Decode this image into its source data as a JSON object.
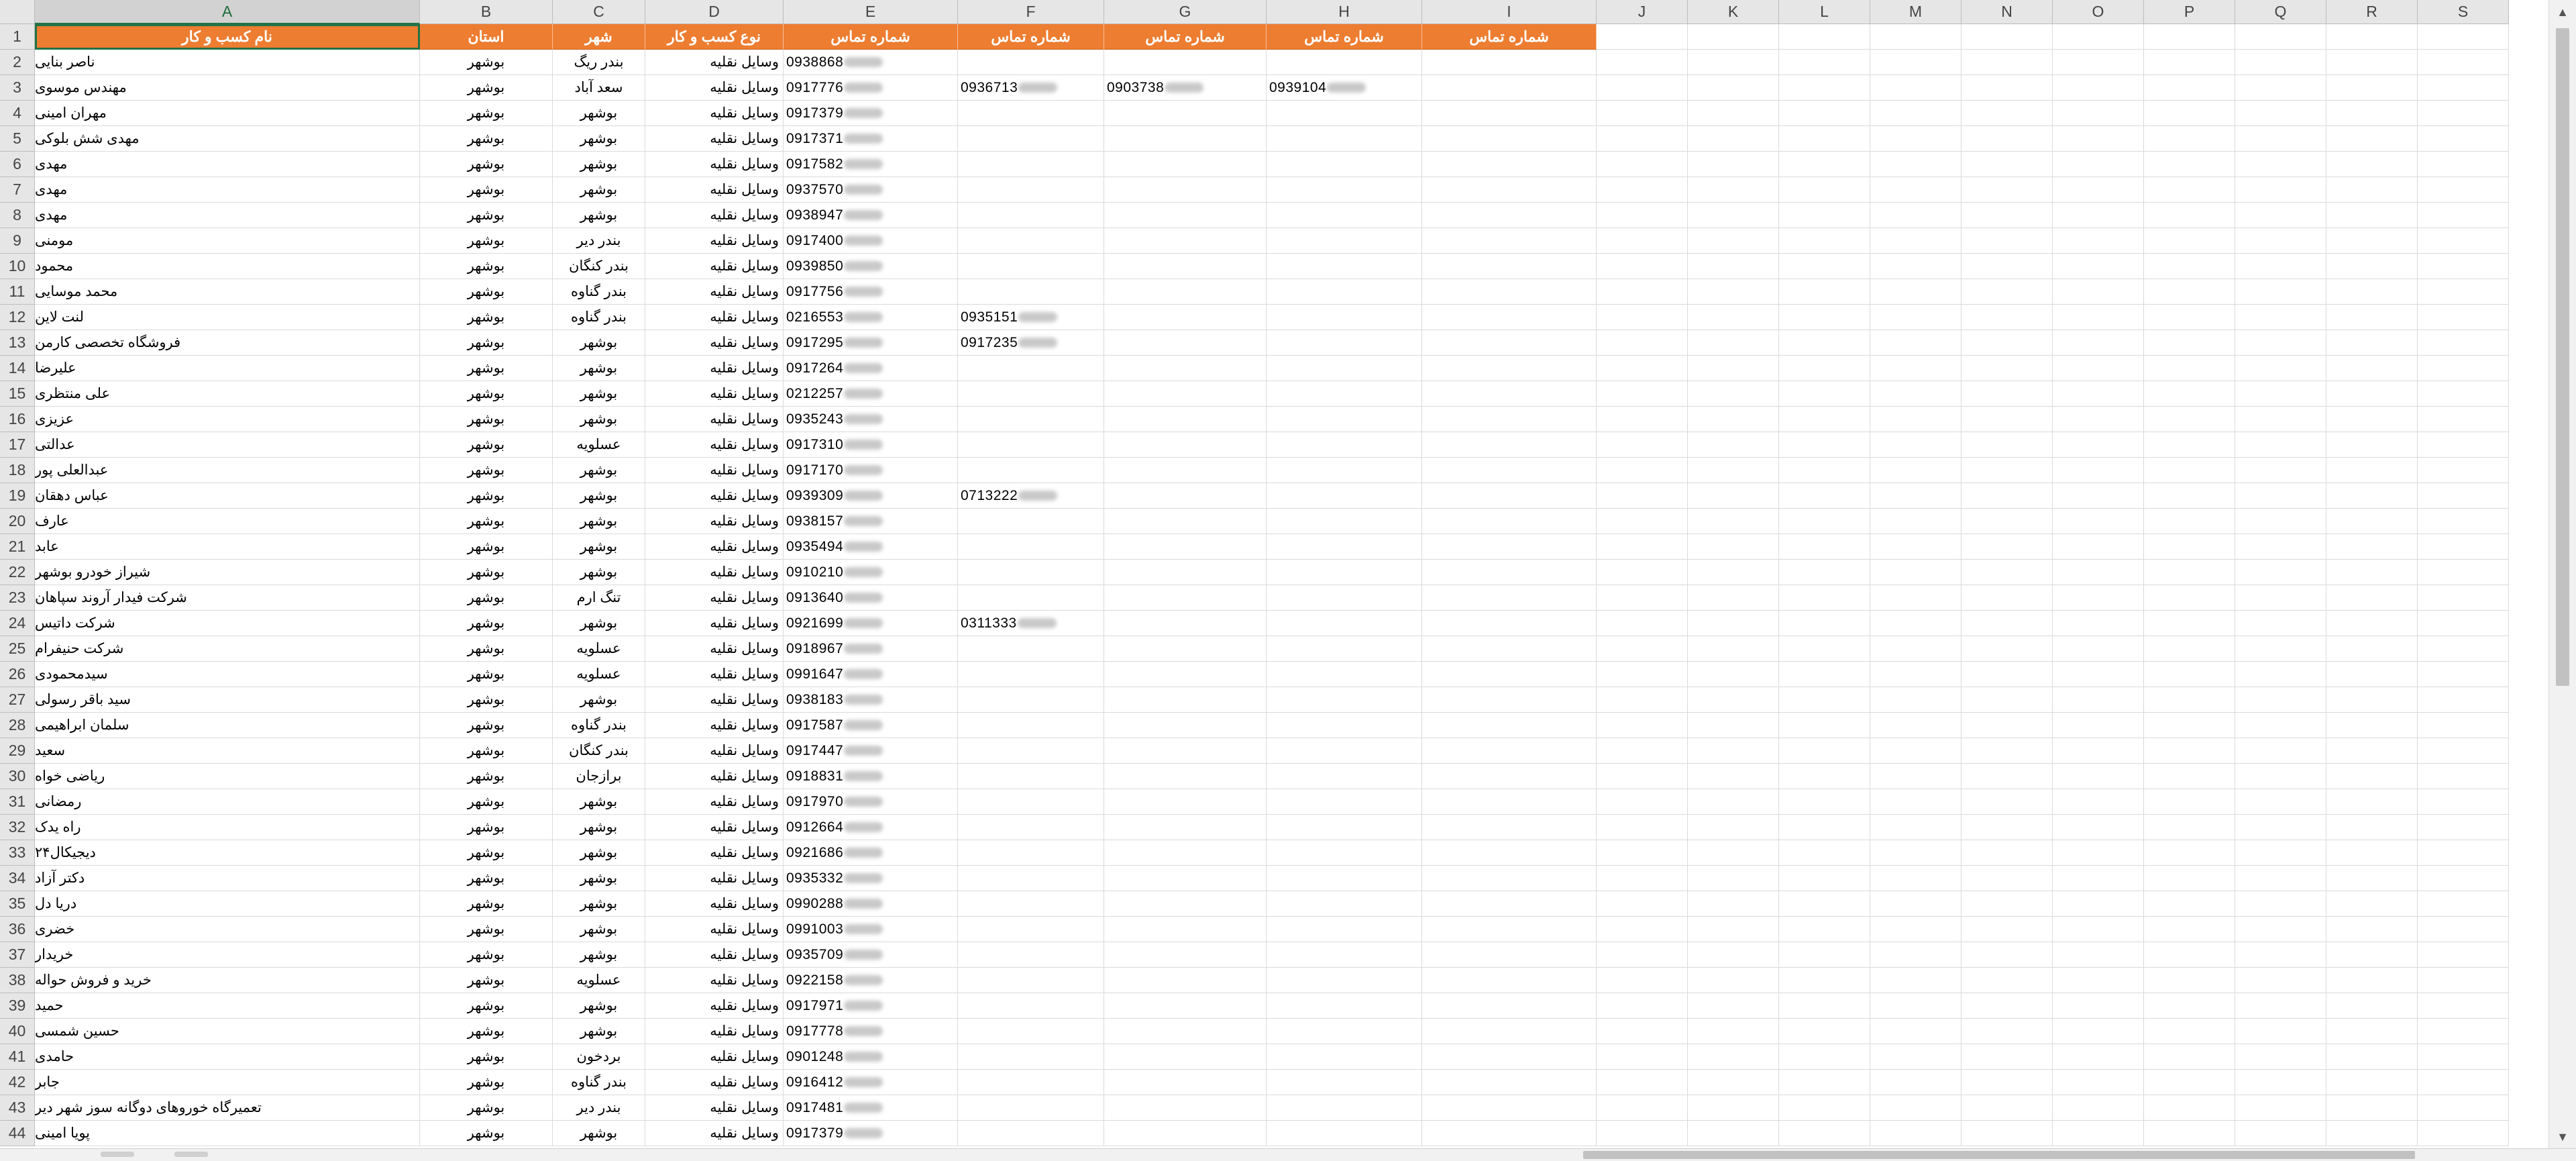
{
  "columns": [
    "A",
    "B",
    "C",
    "D",
    "E",
    "F",
    "G",
    "H",
    "I",
    "J",
    "K",
    "L",
    "M",
    "N",
    "O",
    "P",
    "Q",
    "R",
    "S"
  ],
  "headers": {
    "A": "نام کسب و کار",
    "B": "استان",
    "C": "شهر",
    "D": "نوع کسب و کار",
    "E": "شماره تماس",
    "F": "شماره تماس",
    "G": "شماره تماس",
    "H": "شماره تماس",
    "I": "شماره تماس"
  },
  "rows": [
    {
      "n": "2",
      "name": "ناصر بنایی",
      "state": "بوشهر",
      "city": "بندر ریگ",
      "type": "وسایل نقلیه",
      "p1": "0938868"
    },
    {
      "n": "3",
      "name": "مهندس موسوی",
      "state": "بوشهر",
      "city": "سعد آباد",
      "type": "وسایل نقلیه",
      "p1": "0917776",
      "p2": "0936713",
      "p3": "0903738",
      "p4": "0939104"
    },
    {
      "n": "4",
      "name": "مهران امینی",
      "state": "بوشهر",
      "city": "بوشهر",
      "type": "وسایل نقلیه",
      "p1": "0917379"
    },
    {
      "n": "5",
      "name": "مهدی شش بلوکی",
      "state": "بوشهر",
      "city": "بوشهر",
      "type": "وسایل نقلیه",
      "p1": "0917371"
    },
    {
      "n": "6",
      "name": "مهدی",
      "state": "بوشهر",
      "city": "بوشهر",
      "type": "وسایل نقلیه",
      "p1": "0917582"
    },
    {
      "n": "7",
      "name": "مهدی",
      "state": "بوشهر",
      "city": "بوشهر",
      "type": "وسایل نقلیه",
      "p1": "0937570"
    },
    {
      "n": "8",
      "name": "مهدی",
      "state": "بوشهر",
      "city": "بوشهر",
      "type": "وسایل نقلیه",
      "p1": "0938947"
    },
    {
      "n": "9",
      "name": "مومنی",
      "state": "بوشهر",
      "city": "بندر دیر",
      "type": "وسایل نقلیه",
      "p1": "0917400"
    },
    {
      "n": "10",
      "name": "محمود",
      "state": "بوشهر",
      "city": "بندر کنگان",
      "type": "وسایل نقلیه",
      "p1": "0939850"
    },
    {
      "n": "11",
      "name": "محمد موسایی",
      "state": "بوشهر",
      "city": "بندر گناوه",
      "type": "وسایل نقلیه",
      "p1": "0917756"
    },
    {
      "n": "12",
      "name": "لنت لاین",
      "state": "بوشهر",
      "city": "بندر گناوه",
      "type": "وسایل نقلیه",
      "p1": "0216553",
      "p2": "0935151"
    },
    {
      "n": "13",
      "name": "فروشگاه تخصصی کارمن",
      "state": "بوشهر",
      "city": "بوشهر",
      "type": "وسایل نقلیه",
      "p1": "0917295",
      "p2": "0917235"
    },
    {
      "n": "14",
      "name": "علیرضا",
      "state": "بوشهر",
      "city": "بوشهر",
      "type": "وسایل نقلیه",
      "p1": "0917264"
    },
    {
      "n": "15",
      "name": "علی منتظری",
      "state": "بوشهر",
      "city": "بوشهر",
      "type": "وسایل نقلیه",
      "p1": "0212257"
    },
    {
      "n": "16",
      "name": "عزیزی",
      "state": "بوشهر",
      "city": "بوشهر",
      "type": "وسایل نقلیه",
      "p1": "0935243"
    },
    {
      "n": "17",
      "name": "عدالتی",
      "state": "بوشهر",
      "city": "عسلویه",
      "type": "وسایل نقلیه",
      "p1": "0917310"
    },
    {
      "n": "18",
      "name": "عبدالعلی پور",
      "state": "بوشهر",
      "city": "بوشهر",
      "type": "وسایل نقلیه",
      "p1": "0917170"
    },
    {
      "n": "19",
      "name": "عباس دهقان",
      "state": "بوشهر",
      "city": "بوشهر",
      "type": "وسایل نقلیه",
      "p1": "0939309",
      "p2": "0713222"
    },
    {
      "n": "20",
      "name": "عارف",
      "state": "بوشهر",
      "city": "بوشهر",
      "type": "وسایل نقلیه",
      "p1": "0938157"
    },
    {
      "n": "21",
      "name": "عابد",
      "state": "بوشهر",
      "city": "بوشهر",
      "type": "وسایل نقلیه",
      "p1": "0935494"
    },
    {
      "n": "22",
      "name": "شیراز خودرو بوشهر",
      "state": "بوشهر",
      "city": "بوشهر",
      "type": "وسایل نقلیه",
      "p1": "0910210"
    },
    {
      "n": "23",
      "name": "شرکت فیدار آروند سپاهان",
      "state": "بوشهر",
      "city": "تنگ ارم",
      "type": "وسایل نقلیه",
      "p1": "0913640"
    },
    {
      "n": "24",
      "name": "شرکت داتیس",
      "state": "بوشهر",
      "city": "بوشهر",
      "type": "وسایل نقلیه",
      "p1": "0921699",
      "p2": "0311333"
    },
    {
      "n": "25",
      "name": "شرکت حنیفرام",
      "state": "بوشهر",
      "city": "عسلویه",
      "type": "وسایل نقلیه",
      "p1": "0918967"
    },
    {
      "n": "26",
      "name": "سیدمحمودی",
      "state": "بوشهر",
      "city": "عسلویه",
      "type": "وسایل نقلیه",
      "p1": "0991647"
    },
    {
      "n": "27",
      "name": "سید باقر رسولی",
      "state": "بوشهر",
      "city": "بوشهر",
      "type": "وسایل نقلیه",
      "p1": "0938183"
    },
    {
      "n": "28",
      "name": "سلمان ابراهیمی",
      "state": "بوشهر",
      "city": "بندر گناوه",
      "type": "وسایل نقلیه",
      "p1": "0917587"
    },
    {
      "n": "29",
      "name": "سعید",
      "state": "بوشهر",
      "city": "بندر کنگان",
      "type": "وسایل نقلیه",
      "p1": "0917447"
    },
    {
      "n": "30",
      "name": "ریاضی خواه",
      "state": "بوشهر",
      "city": "برازجان",
      "type": "وسایل نقلیه",
      "p1": "0918831"
    },
    {
      "n": "31",
      "name": "رمضانی",
      "state": "بوشهر",
      "city": "بوشهر",
      "type": "وسایل نقلیه",
      "p1": "0917970"
    },
    {
      "n": "32",
      "name": "راه یدک",
      "state": "بوشهر",
      "city": "بوشهر",
      "type": "وسایل نقلیه",
      "p1": "0912664"
    },
    {
      "n": "33",
      "name": "دیجیکال۲۴",
      "state": "بوشهر",
      "city": "بوشهر",
      "type": "وسایل نقلیه",
      "p1": "0921686"
    },
    {
      "n": "34",
      "name": "دکتر آزاد",
      "state": "بوشهر",
      "city": "بوشهر",
      "type": "وسایل نقلیه",
      "p1": "0935332"
    },
    {
      "n": "35",
      "name": "دریا دل",
      "state": "بوشهر",
      "city": "بوشهر",
      "type": "وسایل نقلیه",
      "p1": "0990288"
    },
    {
      "n": "36",
      "name": "خضری",
      "state": "بوشهر",
      "city": "بوشهر",
      "type": "وسایل نقلیه",
      "p1": "0991003"
    },
    {
      "n": "37",
      "name": "خریدار",
      "state": "بوشهر",
      "city": "بوشهر",
      "type": "وسایل نقلیه",
      "p1": "0935709"
    },
    {
      "n": "38",
      "name": "خرید و فروش حواله",
      "state": "بوشهر",
      "city": "عسلویه",
      "type": "وسایل نقلیه",
      "p1": "0922158"
    },
    {
      "n": "39",
      "name": "حمید",
      "state": "بوشهر",
      "city": "بوشهر",
      "type": "وسایل نقلیه",
      "p1": "0917971"
    },
    {
      "n": "40",
      "name": "حسین شمسی",
      "state": "بوشهر",
      "city": "بوشهر",
      "type": "وسایل نقلیه",
      "p1": "0917778"
    },
    {
      "n": "41",
      "name": "حامدی",
      "state": "بوشهر",
      "city": "بردخون",
      "type": "وسایل نقلیه",
      "p1": "0901248"
    },
    {
      "n": "42",
      "name": "جابر",
      "state": "بوشهر",
      "city": "بندر گناوه",
      "type": "وسایل نقلیه",
      "p1": "0916412"
    },
    {
      "n": "43",
      "name": "تعمیرگاه خوروهای دوگانه سوز شهر دیر",
      "state": "بوشهر",
      "city": "بندر دیر",
      "type": "وسایل نقلیه",
      "p1": "0917481"
    },
    {
      "n": "44",
      "name": "پویا امینی",
      "state": "بوشهر",
      "city": "بوشهر",
      "type": "وسایل نقلیه",
      "p1": "0917379"
    }
  ],
  "header_row_number": "1",
  "accent": "#ed7d31",
  "icons": {
    "scroll_up": "triangle-up",
    "scroll_down": "triangle-down"
  }
}
